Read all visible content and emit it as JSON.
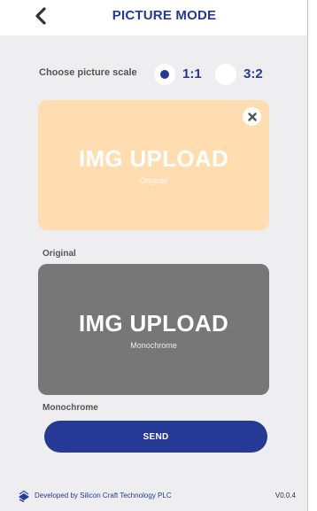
{
  "header": {
    "title": "PICTURE MODE",
    "back_icon": "chevron-left-icon"
  },
  "scale": {
    "label": "Choose picture scale",
    "options": [
      {
        "label": "1:1",
        "selected": true
      },
      {
        "label": "3:2",
        "selected": false
      }
    ]
  },
  "original": {
    "upload_text": "IMG UPLOAD",
    "caption": "Original",
    "section_label": "Original",
    "close_icon": "close-icon",
    "color": "#ffddb0"
  },
  "monochrome": {
    "upload_text": "IMG UPLOAD",
    "caption": "Monochrome",
    "section_label": "Monochrome",
    "color": "#777777"
  },
  "send_button": {
    "label": "SEND"
  },
  "footer": {
    "credit": "Developed by Silicon Craft Technology PLC",
    "version": "V0.0.4",
    "logo_icon": "company-logo-icon"
  },
  "colors": {
    "accent": "#253a94",
    "background": "#eeeef0"
  }
}
